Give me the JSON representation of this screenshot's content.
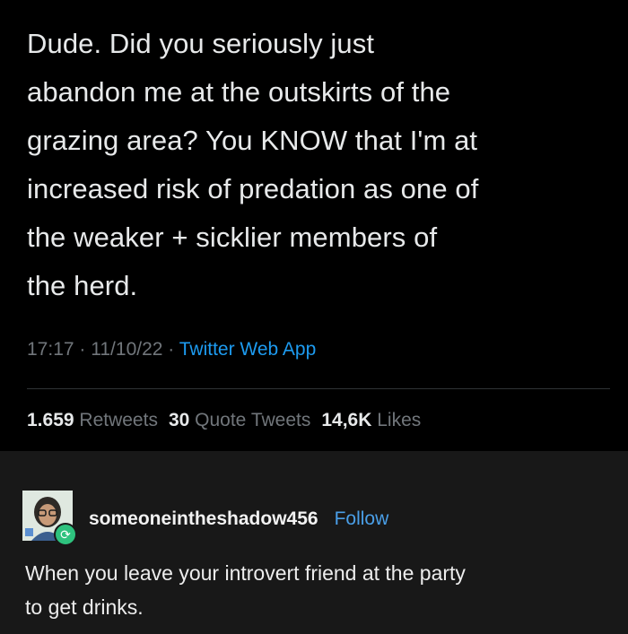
{
  "tweet": {
    "lines": [
      "Dude. Did you seriously just",
      "abandon me at the outskirts of the",
      "grazing area? You KNOW that I'm at",
      "increased risk of predation as one of",
      "the weaker + sicklier members of",
      "the herd."
    ],
    "time": "17:17",
    "date": "11/10/22",
    "separator": "·",
    "source": "Twitter Web App",
    "stats": {
      "retweets_count": "1.659",
      "retweets_label": "Retweets",
      "quotes_count": "30",
      "quotes_label": "Quote Tweets",
      "likes_count": "14,6K",
      "likes_label": "Likes"
    }
  },
  "tumblr": {
    "username": "someoneintheshadow456",
    "follow_label": "Follow",
    "badge_icon": "reblog-icon",
    "avatar_icon": "user-avatar",
    "lines": [
      "When you leave your introvert friend at the party",
      "to get drinks."
    ]
  },
  "colors": {
    "tweet_bg": "#000000",
    "tumblr_bg": "#181818",
    "accent_blue": "#1d9bf0",
    "follow_blue": "#4a9fe8",
    "badge_green": "#2ec27e"
  }
}
